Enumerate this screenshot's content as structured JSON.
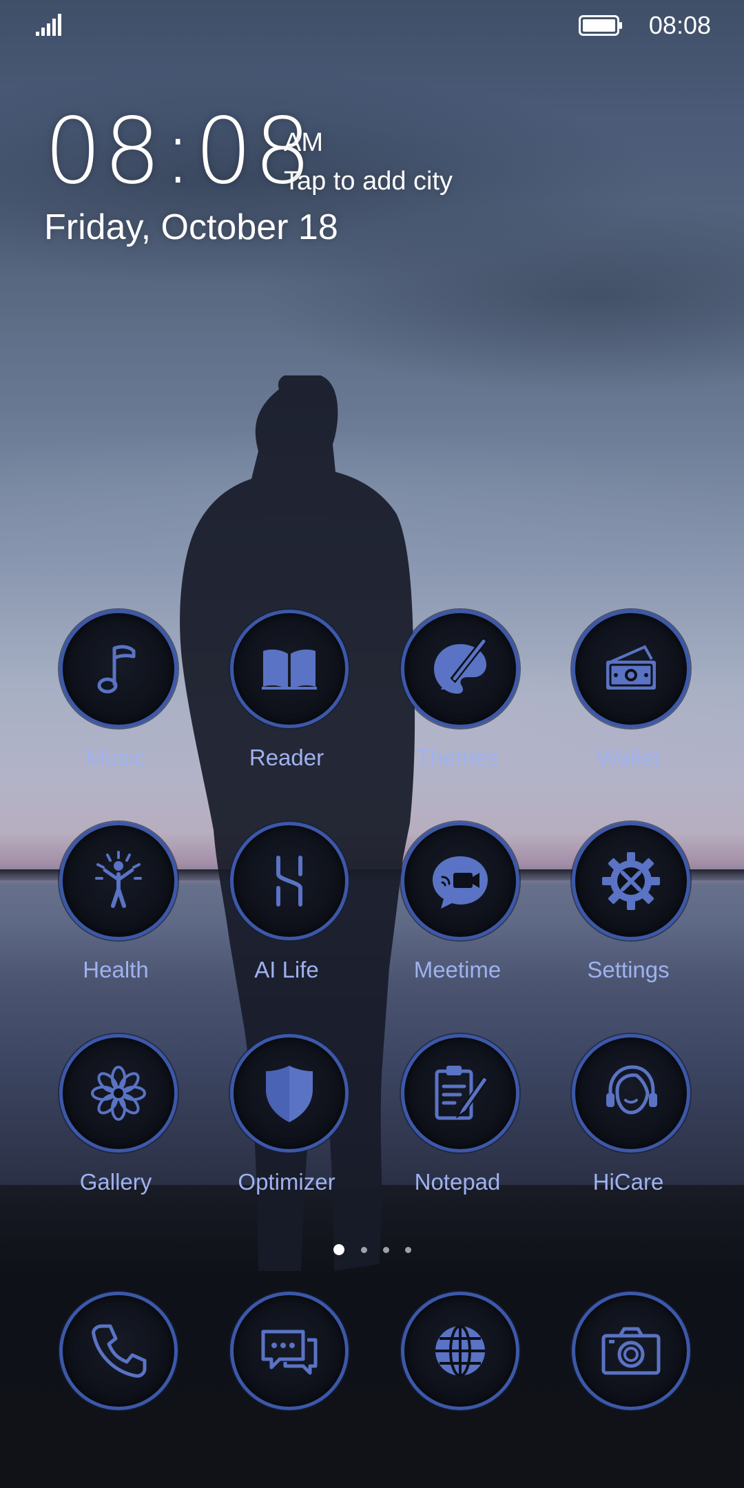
{
  "status_bar": {
    "time": "08:08",
    "icons": [
      "signal-icon",
      "battery-icon"
    ]
  },
  "clock_widget": {
    "time": "08:08",
    "ampm": "AM",
    "city": "Tap to add city",
    "date": "Friday, October 18"
  },
  "apps": [
    {
      "label": "Music",
      "icon": "music-note-icon"
    },
    {
      "label": "Reader",
      "icon": "book-icon"
    },
    {
      "label": "Themes",
      "icon": "paint-brush-icon"
    },
    {
      "label": "Wallet",
      "icon": "wallet-icon"
    },
    {
      "label": "Health",
      "icon": "health-person-icon"
    },
    {
      "label": "AI Life",
      "icon": "ai-life-icon"
    },
    {
      "label": "Meetime",
      "icon": "video-chat-icon"
    },
    {
      "label": "Settings",
      "icon": "gear-icon"
    },
    {
      "label": "Gallery",
      "icon": "flower-icon"
    },
    {
      "label": "Optimizer",
      "icon": "shield-icon"
    },
    {
      "label": "Notepad",
      "icon": "notepad-icon"
    },
    {
      "label": "HiCare",
      "icon": "headset-icon"
    }
  ],
  "page_indicator": {
    "count": 4,
    "active_index": 0
  },
  "dock": [
    {
      "icon": "phone-icon"
    },
    {
      "icon": "messages-icon"
    },
    {
      "icon": "browser-globe-icon"
    },
    {
      "icon": "camera-icon"
    }
  ],
  "colors": {
    "icon_ring": "#3d58a8",
    "icon_glyph": "#5a73c4",
    "label": "#9fb2f0"
  }
}
